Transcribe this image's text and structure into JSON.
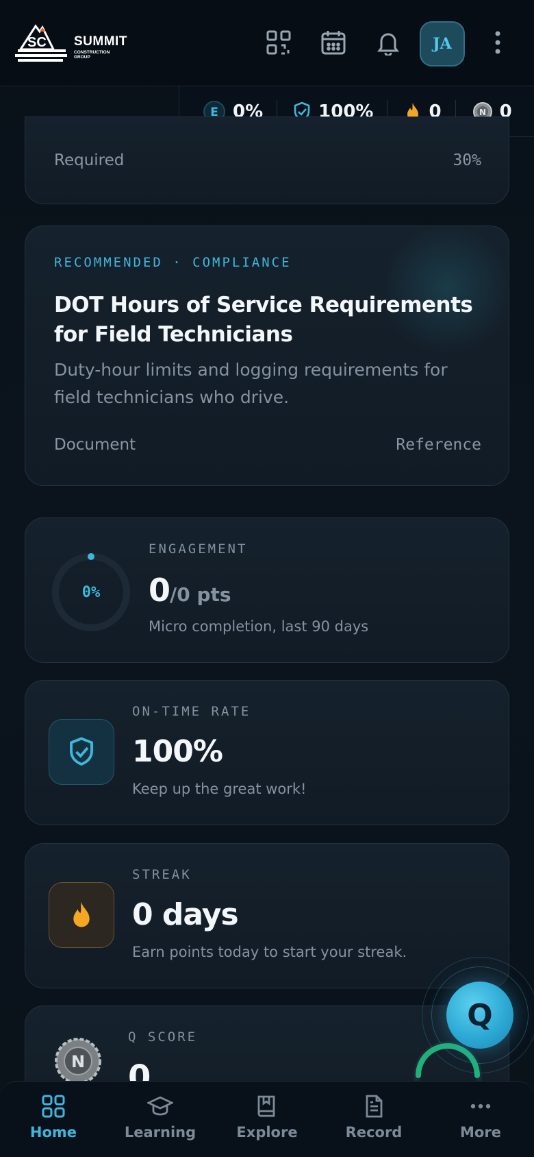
{
  "header": {
    "logo": {
      "brand": "SUMMIT",
      "tagline": "CONSTRUCTION GROUP"
    },
    "avatar_initials": "JA"
  },
  "stats": {
    "engagement": {
      "letter": "E",
      "value": "0%"
    },
    "on_time": {
      "value": "100%"
    },
    "streak": {
      "value": "0"
    },
    "q_score": {
      "value": "0"
    }
  },
  "required_card": {
    "label": "Required",
    "value": "30%"
  },
  "recommended": {
    "kicker": "RECOMMENDED · COMPLIANCE",
    "title": "DOT Hours of Service Requirements for Field Technicians",
    "description": "Duty-hour limits and logging requirements for field technicians who drive.",
    "type": "Document",
    "tag": "Reference"
  },
  "engagement_card": {
    "kicker": "ENGAGEMENT",
    "ring_label": "0%",
    "ring_progress": 0,
    "points": "0",
    "points_total": "/0 pts",
    "subtitle": "Micro completion, last 90 days"
  },
  "on_time_card": {
    "kicker": "ON-TIME RATE",
    "value": "100%",
    "subtitle": "Keep up the great work!"
  },
  "streak_card": {
    "kicker": "STREAK",
    "value": "0 days",
    "subtitle": "Earn points today to start your streak."
  },
  "q_score_card": {
    "kicker": "Q SCORE",
    "value": "0"
  },
  "fab": {
    "label": "Q"
  },
  "nav": {
    "items": [
      {
        "label": "Home"
      },
      {
        "label": "Learning"
      },
      {
        "label": "Explore"
      },
      {
        "label": "Record"
      },
      {
        "label": "More"
      }
    ]
  },
  "colors": {
    "accent": "#3fb7dc",
    "background": "#0a1119",
    "card": "#141f2a",
    "streak": "#f5a623"
  }
}
